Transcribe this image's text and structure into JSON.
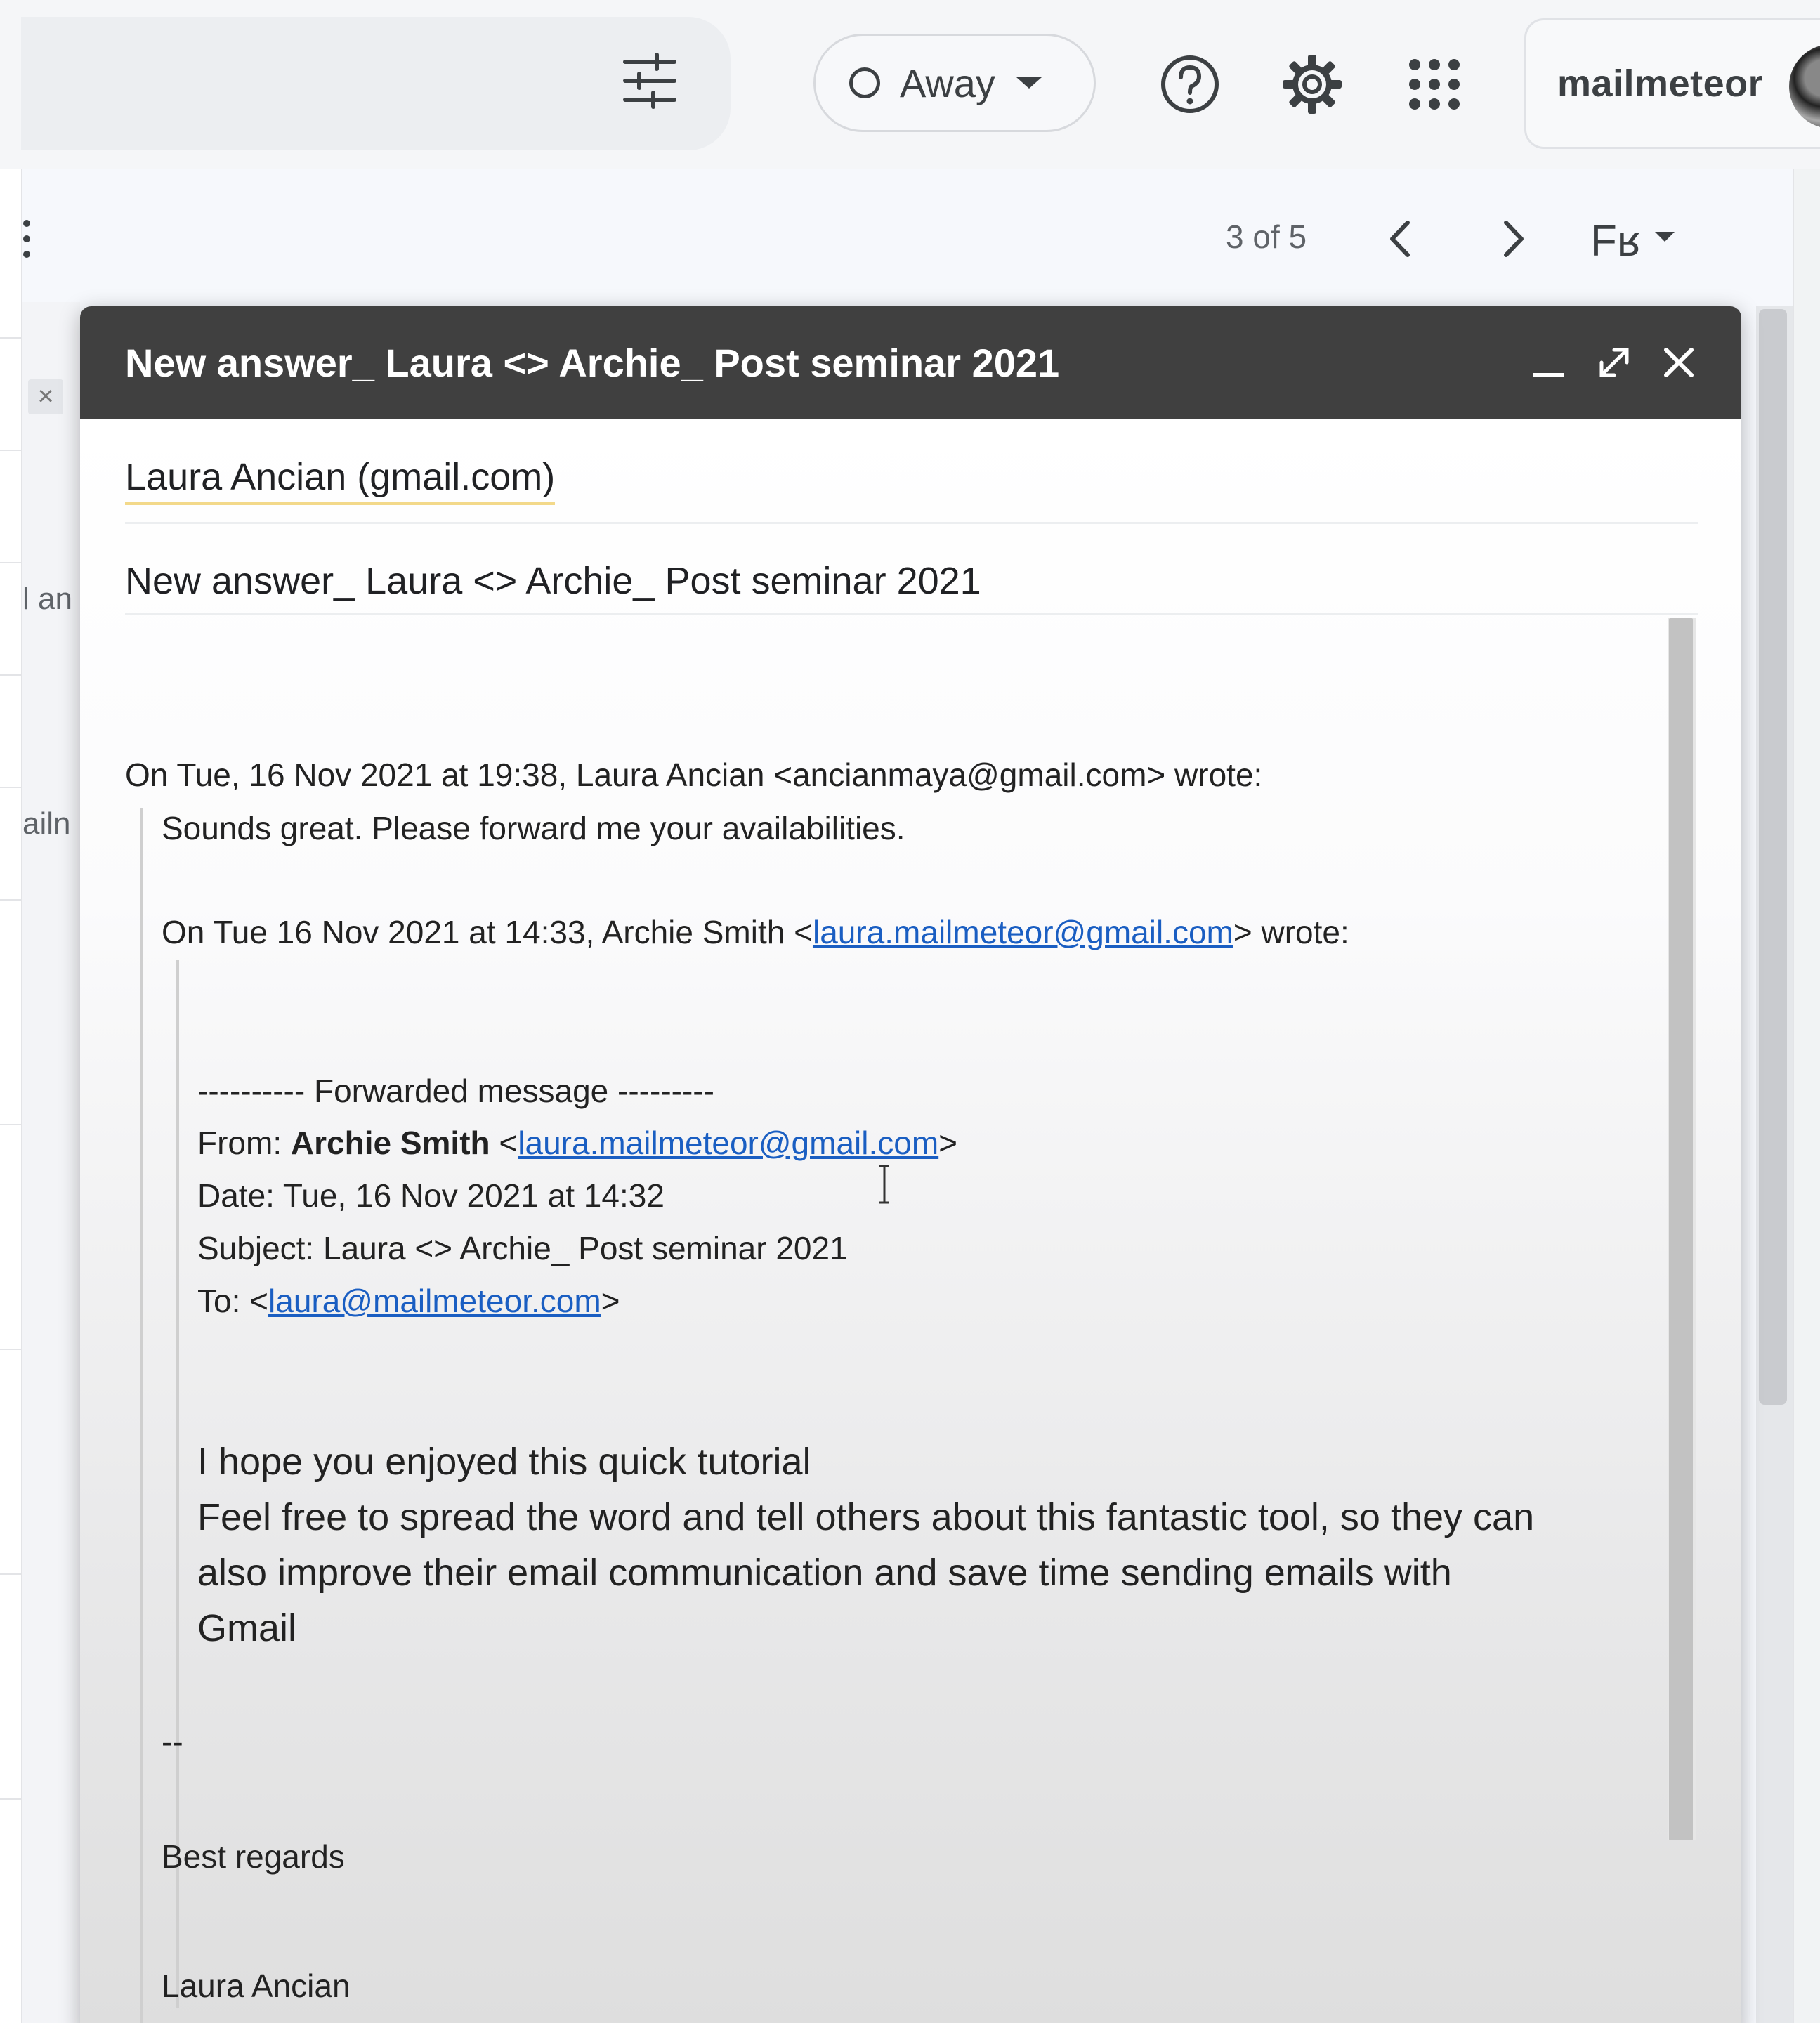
{
  "topbar": {
    "status_label": "Away",
    "account_name": "mailmeteor"
  },
  "toolbar": {
    "pager": "3 of 5",
    "input_tools_label": "Fʁ"
  },
  "left_strip": {
    "fragment_1": "l an",
    "fragment_2": "ailn",
    "close_glyph": "×"
  },
  "compose": {
    "title": "New answer_ Laura <> Archie_ Post seminar 2021",
    "recipient": "Laura Ancian (gmail.com)",
    "subject": "New answer_ Laura <> Archie_ Post seminar 2021",
    "body": {
      "attribution_1": "On Tue, 16 Nov 2021 at 19:38, Laura Ancian <ancianmaya@gmail.com> wrote:",
      "reply_1": "Sounds great. Please forward me your availabilities.",
      "attribution_2_prefix": "On Tue 16 Nov 2021 at 14:33, Archie Smith <",
      "attribution_2_email": "laura.mailmeteor@gmail.com",
      "attribution_2_suffix": "> wrote:",
      "forwarded_header": "---------- Forwarded message ---------",
      "from_label": "From: ",
      "from_name": "Archie Smith",
      "from_email_open": " <",
      "from_email": "laura.mailmeteor@gmail.com",
      "from_email_close": ">",
      "date_line": "Date: Tue, 16 Nov 2021 at 14:32",
      "subject_line": "Subject: Laura <> Archie_ Post seminar 2021",
      "to_label": "To: <",
      "to_email": "laura@mailmeteor.com",
      "to_close": ">",
      "message_1": "I hope you enjoyed this quick tutorial",
      "message_2": "Feel free to spread the word and tell others about this fantastic tool, so they can",
      "message_3": "also improve their email communication and save time sending emails with",
      "message_4": "Gmail",
      "sig_separator": "--",
      "closing": "Best regards",
      "signature_name": "Laura Ancian"
    }
  },
  "colors": {
    "header_bg": "#404040",
    "link": "#1a5ec2",
    "recipient_underline": "#f3d98a"
  },
  "icons": [
    "filter-icon",
    "help-icon",
    "gear-icon",
    "apps-grid-icon",
    "more-vert-icon",
    "chevron-left-icon",
    "chevron-right-icon",
    "minimize-icon",
    "expand-icon",
    "close-icon",
    "text-cursor-icon"
  ]
}
